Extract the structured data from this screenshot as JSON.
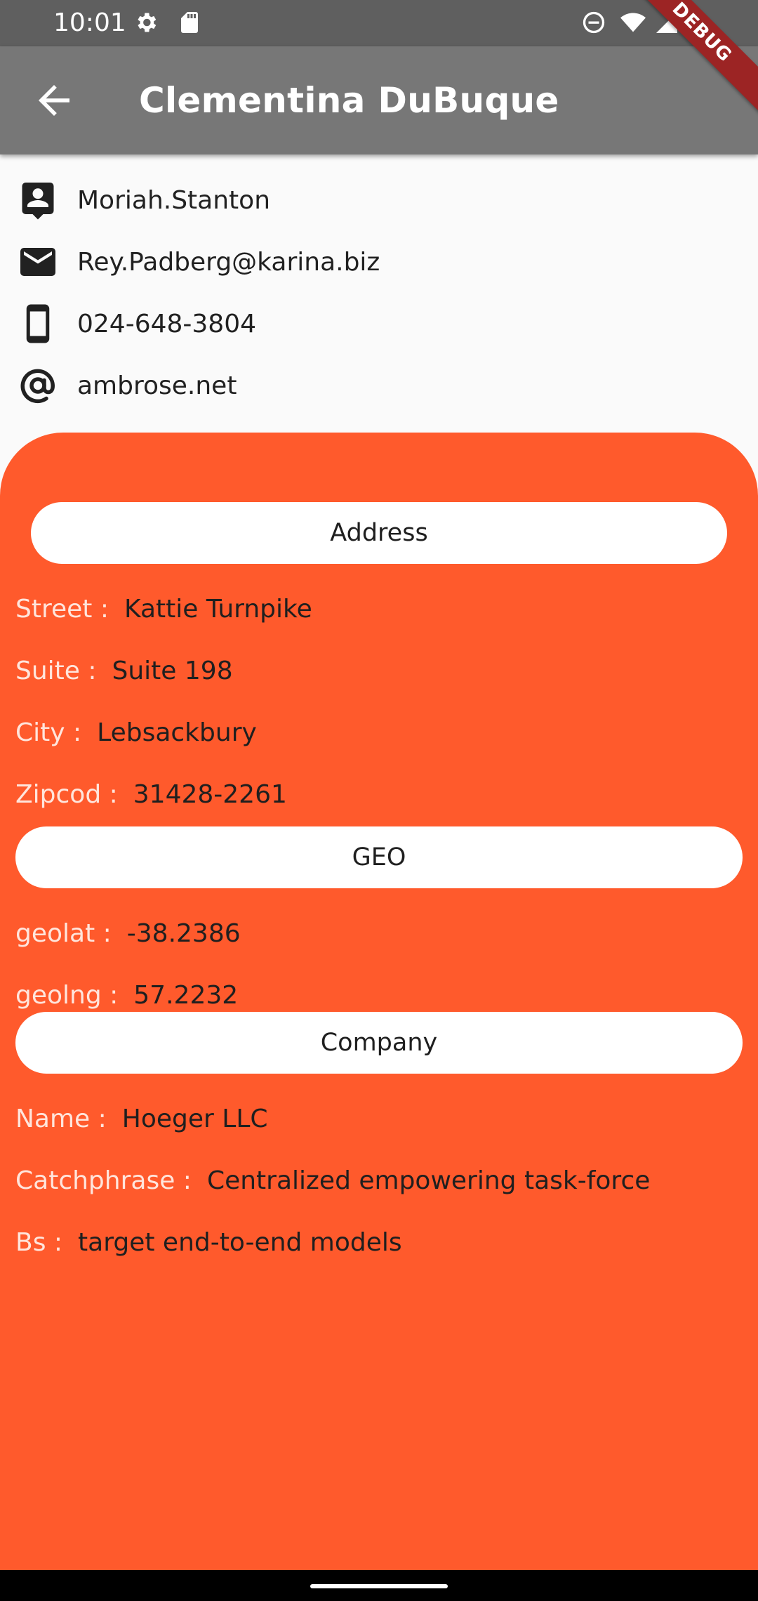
{
  "status_bar": {
    "time": "10:01"
  },
  "app_bar": {
    "title": "Clementina DuBuque",
    "debug_label": "DEBUG"
  },
  "contact": {
    "username": "Moriah.Stanton",
    "email": "Rey.Padberg@karina.biz",
    "phone": "024-648-3804",
    "website": "ambrose.net"
  },
  "address": {
    "section_label": "Address",
    "street_label": "Street :",
    "street": "Kattie Turnpike",
    "suite_label": "Suite :",
    "suite": "Suite 198",
    "city_label": "City :",
    "city": "Lebsackbury",
    "zip_label": "Zipcod :",
    "zip": "31428-2261"
  },
  "geo": {
    "section_label": "GEO",
    "lat_label": "geolat :",
    "lat": "-38.2386",
    "lng_label": "geolng :",
    "lng": "57.2232"
  },
  "company": {
    "section_label": "Company",
    "name_label": "Name :",
    "name": "Hoeger LLC",
    "catchphrase_label": "Catchphrase :",
    "catchphrase": "Centralized empowering task-force",
    "bs_label": "Bs :",
    "bs": "target end-to-end models"
  },
  "colors": {
    "accent": "#ff5a2c",
    "app_bar": "#777777",
    "status_bar": "#5f5f5f"
  }
}
